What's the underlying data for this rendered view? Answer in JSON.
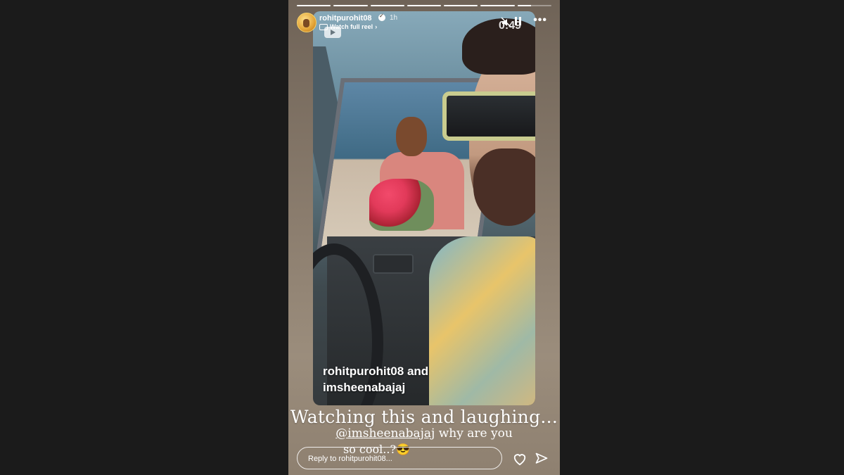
{
  "story": {
    "progress_segments": [
      1,
      1,
      1,
      1,
      1,
      1,
      0.4
    ],
    "username": "rohitpurohit08",
    "time_ago": "1h",
    "watch_full_reel": "Watch full reel",
    "icons": {
      "mute": "mute-icon",
      "pause": "pause-icon",
      "more": "more-icon",
      "verified": "verified-icon",
      "camera": "reel-camera-icon",
      "heart": "heart-icon",
      "send": "send-icon",
      "play": "play-icon"
    }
  },
  "video": {
    "duration": "0:49",
    "caption_line1": "rohitpurohit08 and",
    "caption_line2": "imsheenabajaj"
  },
  "overlay": {
    "title": "Watching this and laughing...",
    "mention": "@imsheenabajaj",
    "line2_rest": " why are you",
    "line3": "so cool..?😎"
  },
  "reply": {
    "placeholder": "Reply to rohitpurohit08..."
  },
  "colors": {
    "page_background": "#1b1b1b",
    "story_background": "#8a7c6d",
    "text": "#ffffff"
  }
}
